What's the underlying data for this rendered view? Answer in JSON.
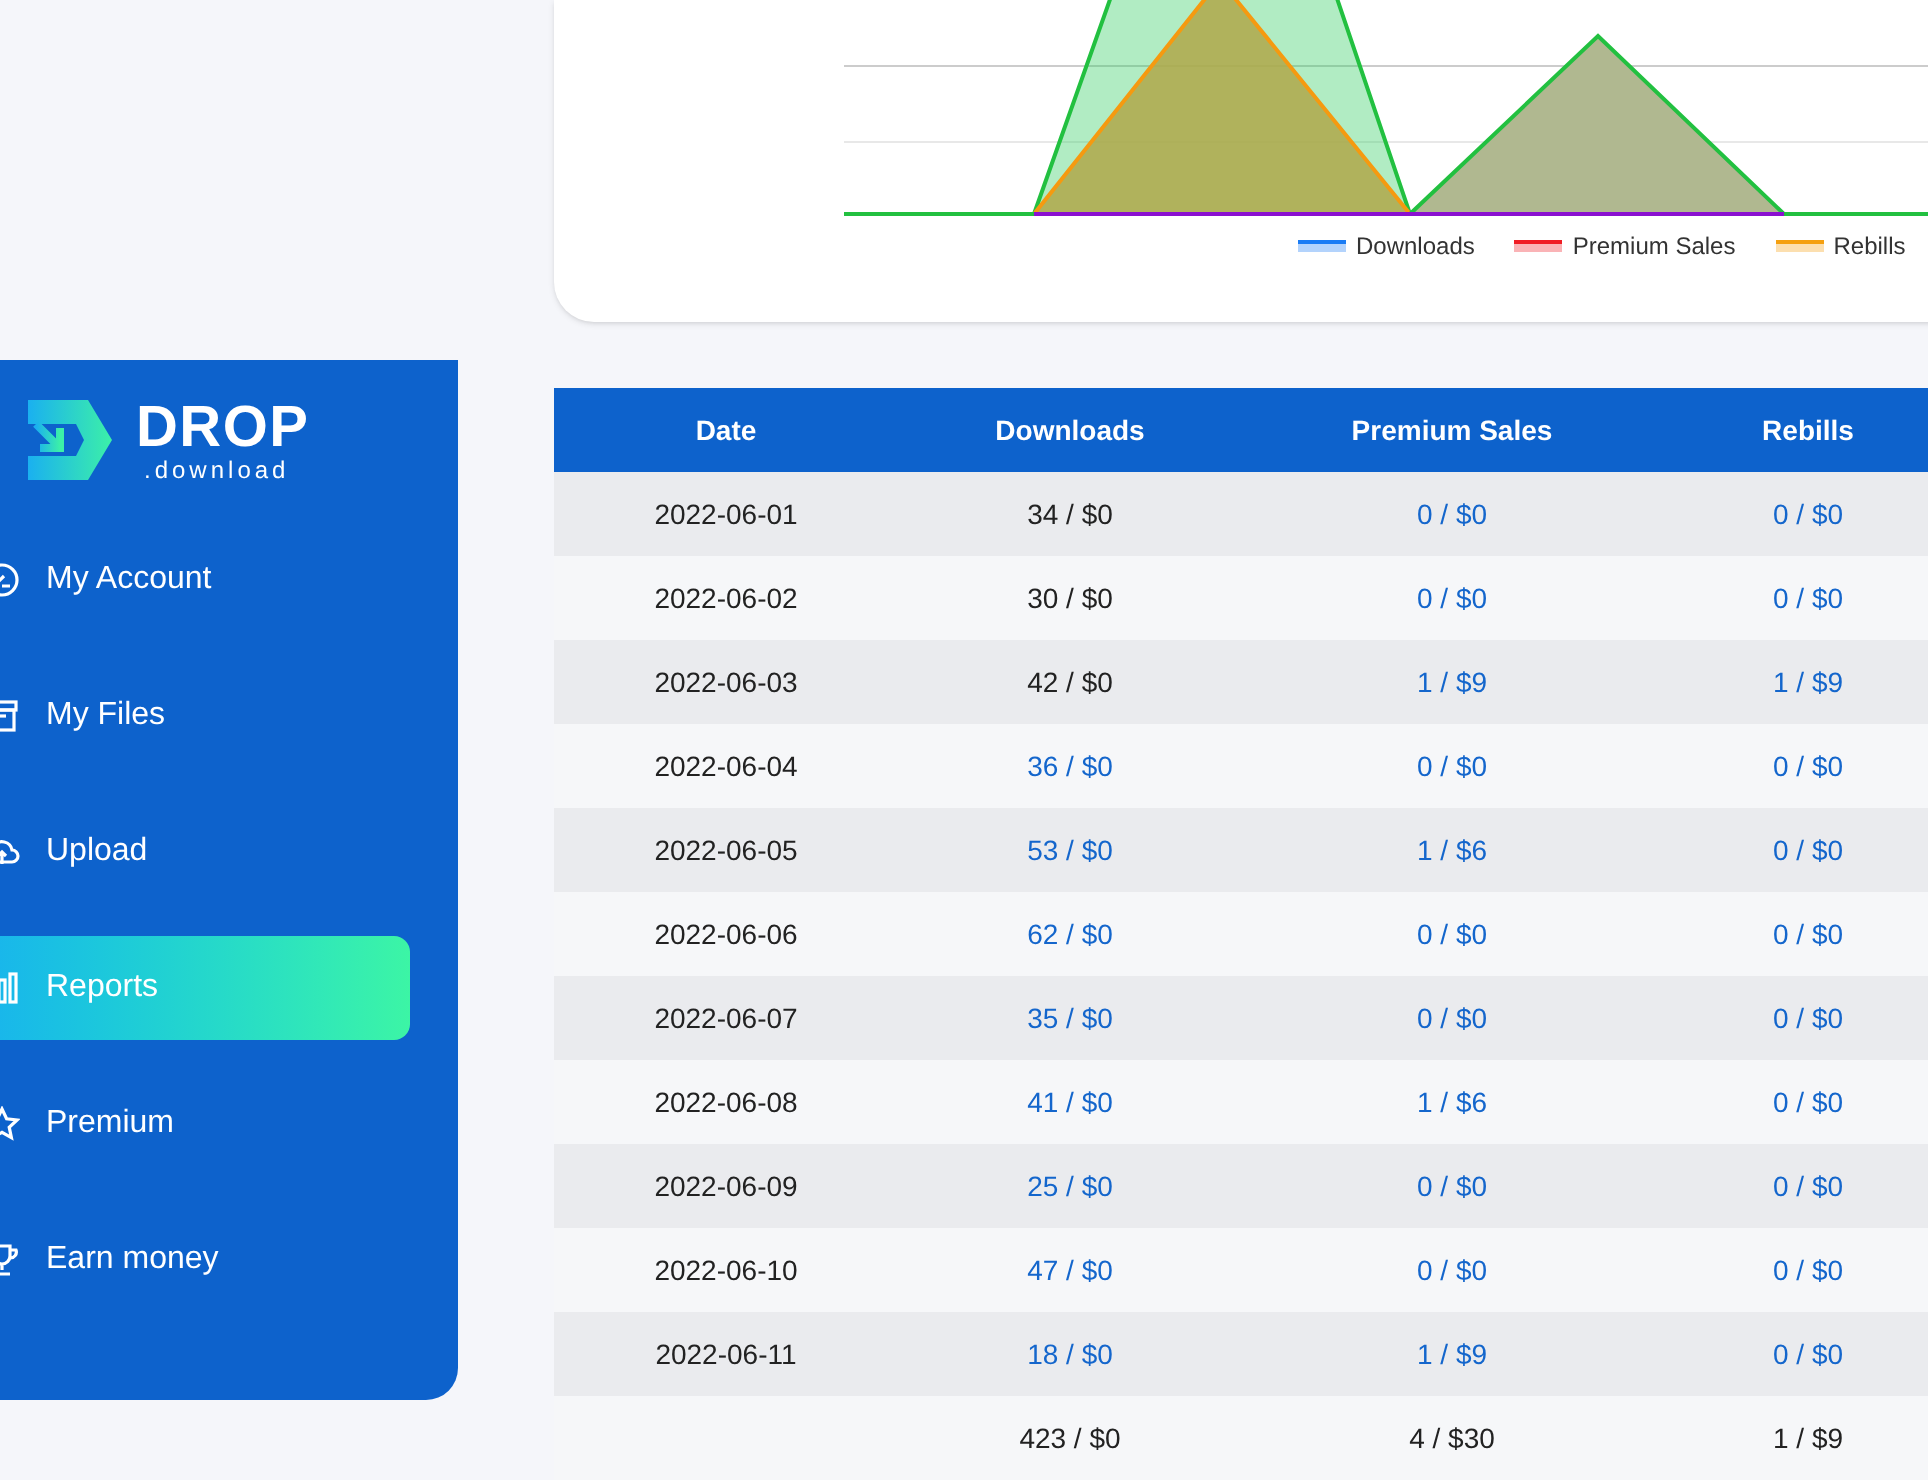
{
  "chart": {
    "legend": [
      {
        "label": "Downloads",
        "color": "#1a7cf5"
      },
      {
        "label": "Premium Sales",
        "color": "#f01c24"
      },
      {
        "label": "Rebills",
        "color": "#f5a00f"
      }
    ]
  },
  "sidebar": {
    "logo": {
      "name": "DROP",
      "subtitle": ".download"
    },
    "items": [
      {
        "label": "My Account",
        "kind": "gauge",
        "selected": false
      },
      {
        "label": "My Files",
        "kind": "archive",
        "selected": false
      },
      {
        "label": "Upload",
        "kind": "cloud",
        "selected": false
      },
      {
        "label": "Reports",
        "kind": "chart",
        "selected": true
      },
      {
        "label": "Premium",
        "kind": "star",
        "selected": false
      },
      {
        "label": "Earn money",
        "kind": "trophy",
        "selected": false
      }
    ]
  },
  "table": {
    "columns": [
      "Date",
      "Downloads",
      "Premium Sales",
      "Rebills"
    ],
    "rows": [
      [
        {
          "text": "2022-06-01",
          "link": false
        },
        {
          "text": "34 / $0",
          "link": false
        },
        {
          "text": "0 / $0",
          "link": true
        },
        {
          "text": "0 / $0",
          "link": true
        }
      ],
      [
        {
          "text": "2022-06-02",
          "link": false
        },
        {
          "text": "30 / $0",
          "link": false
        },
        {
          "text": "0 / $0",
          "link": true
        },
        {
          "text": "0 / $0",
          "link": true
        }
      ],
      [
        {
          "text": "2022-06-03",
          "link": false
        },
        {
          "text": "42 / $0",
          "link": false
        },
        {
          "text": "1 / $9",
          "link": true
        },
        {
          "text": "1 / $9",
          "link": true
        }
      ],
      [
        {
          "text": "2022-06-04",
          "link": false
        },
        {
          "text": "36 / $0",
          "link": true
        },
        {
          "text": "0 / $0",
          "link": true
        },
        {
          "text": "0 / $0",
          "link": true
        }
      ],
      [
        {
          "text": "2022-06-05",
          "link": false
        },
        {
          "text": "53 / $0",
          "link": true
        },
        {
          "text": "1 / $6",
          "link": true
        },
        {
          "text": "0 / $0",
          "link": true
        }
      ],
      [
        {
          "text": "2022-06-06",
          "link": false
        },
        {
          "text": "62 / $0",
          "link": true
        },
        {
          "text": "0 / $0",
          "link": true
        },
        {
          "text": "0 / $0",
          "link": true
        }
      ],
      [
        {
          "text": "2022-06-07",
          "link": false
        },
        {
          "text": "35 / $0",
          "link": true
        },
        {
          "text": "0 / $0",
          "link": true
        },
        {
          "text": "0 / $0",
          "link": true
        }
      ],
      [
        {
          "text": "2022-06-08",
          "link": false
        },
        {
          "text": "41 / $0",
          "link": true
        },
        {
          "text": "1 / $6",
          "link": true
        },
        {
          "text": "0 / $0",
          "link": true
        }
      ],
      [
        {
          "text": "2022-06-09",
          "link": false
        },
        {
          "text": "25 / $0",
          "link": true
        },
        {
          "text": "0 / $0",
          "link": true
        },
        {
          "text": "0 / $0",
          "link": true
        }
      ],
      [
        {
          "text": "2022-06-10",
          "link": false
        },
        {
          "text": "47 / $0",
          "link": true
        },
        {
          "text": "0 / $0",
          "link": true
        },
        {
          "text": "0 / $0",
          "link": true
        }
      ],
      [
        {
          "text": "2022-06-11",
          "link": false
        },
        {
          "text": "18 / $0",
          "link": true
        },
        {
          "text": "1 / $9",
          "link": true
        },
        {
          "text": "0 / $0",
          "link": true
        }
      ]
    ],
    "totals": [
      "423 / $0",
      "4 / $30",
      "1 / $9"
    ]
  }
}
